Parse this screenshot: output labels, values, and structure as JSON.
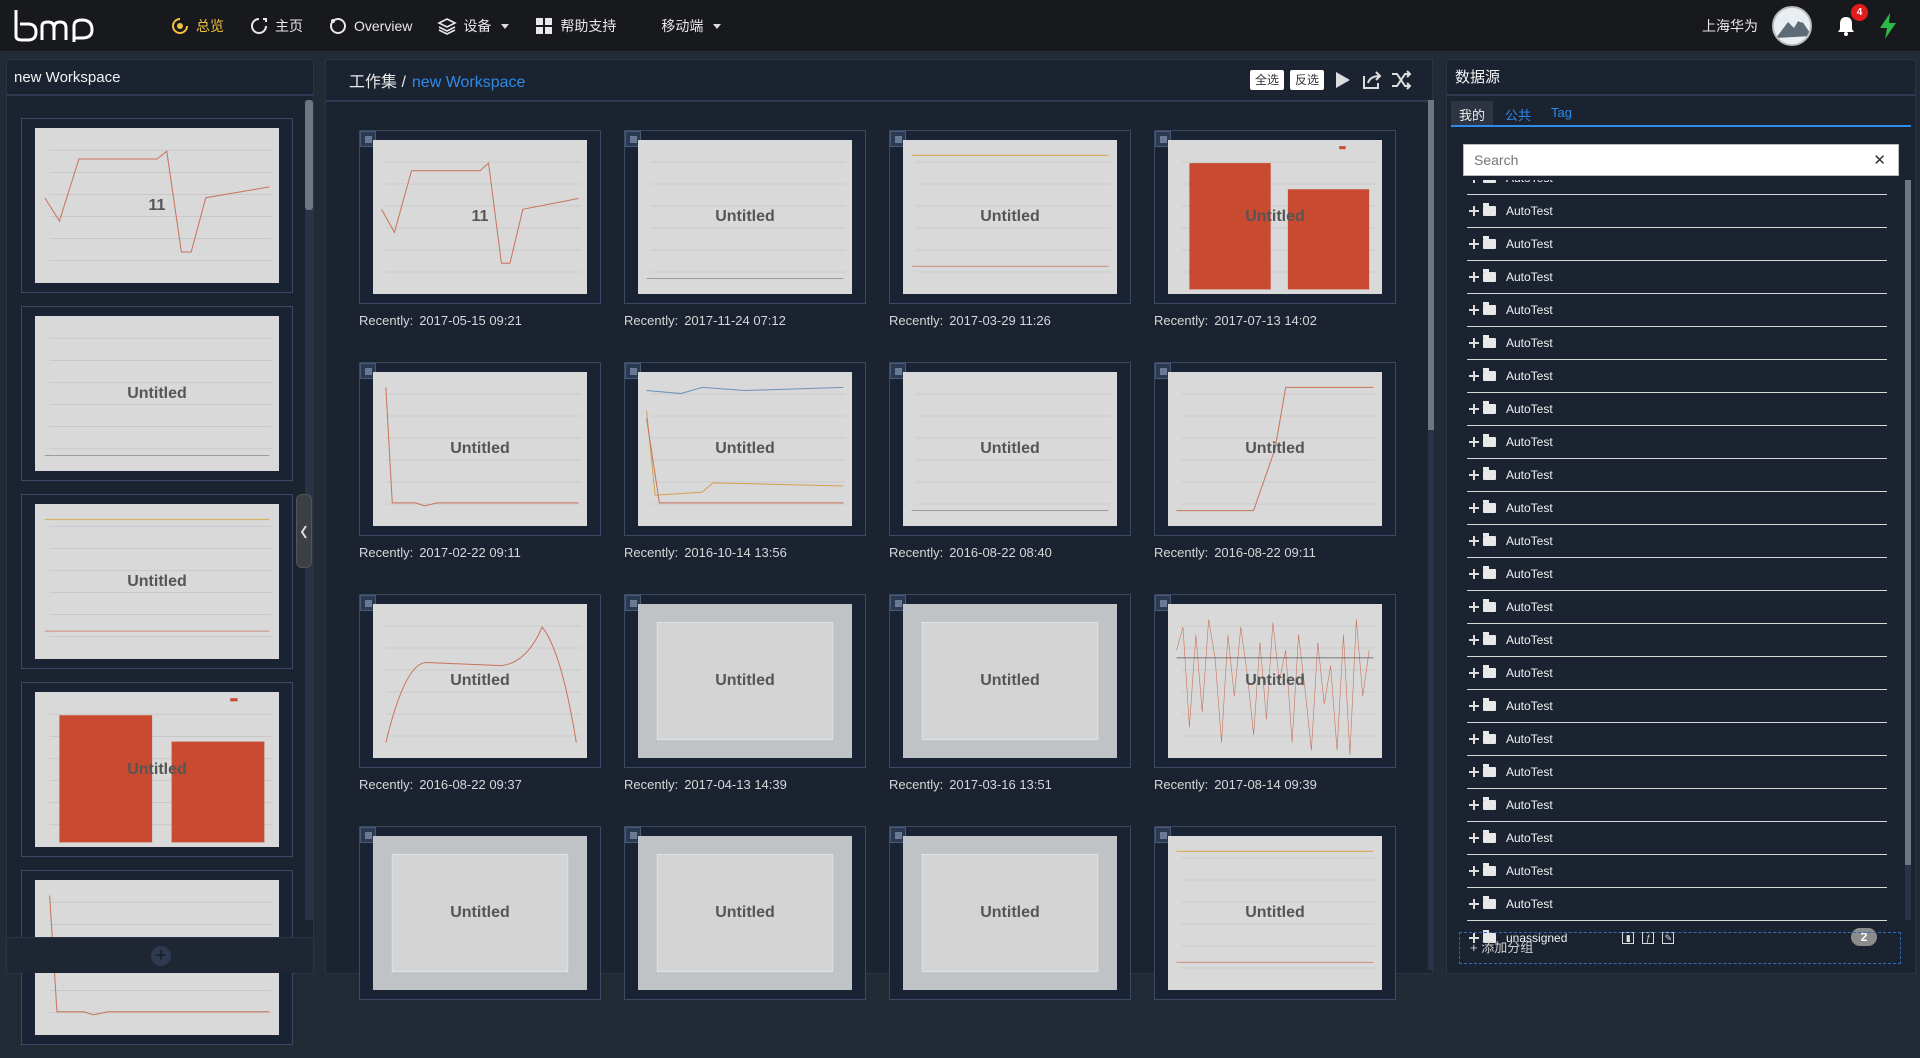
{
  "topbar": {
    "logo": "bm",
    "nav": [
      {
        "label": "总览",
        "icon": "overview-icon",
        "active": true
      },
      {
        "label": "主页",
        "icon": "home-icon",
        "active": false
      },
      {
        "label": "Overview",
        "icon": "overview2-icon",
        "active": false
      },
      {
        "label": "设备",
        "icon": "layers-icon",
        "active": false,
        "dropdown": true
      },
      {
        "label": "帮助支持",
        "icon": "grid-icon",
        "active": false
      },
      {
        "label": "移动端",
        "icon": "",
        "active": false,
        "dropdown": true
      }
    ],
    "user_name": "上海华为",
    "notification_count": "4"
  },
  "left_panel": {
    "title": "new Workspace",
    "thumbs": [
      {
        "title": "11",
        "type": "line1"
      },
      {
        "title": "Untitled",
        "type": "flat"
      },
      {
        "title": "Untitled",
        "type": "flatorange"
      },
      {
        "title": "Untitled",
        "type": "bar"
      },
      {
        "title": "",
        "type": "line2"
      }
    ]
  },
  "center": {
    "crumb_root": "工作集 /",
    "crumb_current": "new Workspace",
    "select_all": "全选",
    "invert_select": "反选",
    "recent_label": "Recently:",
    "cards": [
      {
        "title": "11",
        "date": "2017-05-15 09:21",
        "type": "line1"
      },
      {
        "title": "Untitled",
        "date": "2017-11-24 07:12",
        "type": "flat"
      },
      {
        "title": "Untitled",
        "date": "2017-03-29 11:26",
        "type": "flatorange"
      },
      {
        "title": "Untitled",
        "date": "2017-07-13 14:02",
        "type": "bar"
      },
      {
        "title": "Untitled",
        "date": "2017-02-22 09:11",
        "type": "line2"
      },
      {
        "title": "Untitled",
        "date": "2016-10-14 13:56",
        "type": "multi"
      },
      {
        "title": "Untitled",
        "date": "2016-08-22 08:40",
        "type": "flat"
      },
      {
        "title": "Untitled",
        "date": "2016-08-22 09:11",
        "type": "rise"
      },
      {
        "title": "Untitled",
        "date": "2016-08-22 09:37",
        "type": "hump"
      },
      {
        "title": "Untitled",
        "date": "2017-04-13 14:39",
        "type": "frame"
      },
      {
        "title": "Untitled",
        "date": "2017-03-16 13:51",
        "type": "frame"
      },
      {
        "title": "Untitled",
        "date": "2017-08-14 09:39",
        "type": "spiky"
      },
      {
        "title": "Untitled",
        "date": "",
        "type": "frame"
      },
      {
        "title": "Untitled",
        "date": "",
        "type": "frame"
      },
      {
        "title": "Untitled",
        "date": "",
        "type": "frame"
      },
      {
        "title": "Untitled",
        "date": "",
        "type": "flatorange"
      }
    ]
  },
  "right_panel": {
    "title": "数据源",
    "tabs": [
      {
        "label": "我的",
        "active": true
      },
      {
        "label": "公共",
        "active": false
      },
      {
        "label": "Tag",
        "active": false
      }
    ],
    "search_placeholder": "Search",
    "tree": [
      "AutoTest",
      "AutoTest",
      "AutoTest",
      "AutoTest",
      "AutoTest",
      "AutoTest",
      "AutoTest",
      "AutoTest",
      "AutoTest",
      "AutoTest",
      "AutoTest",
      "AutoTest",
      "AutoTest",
      "AutoTest",
      "AutoTest",
      "AutoTest",
      "AutoTest",
      "AutoTest",
      "AutoTest",
      "AutoTest",
      "AutoTest",
      "AutoTest"
    ],
    "unassigned_label": "unassigned",
    "unassigned_count": "2",
    "add_group": "+ 添加分组"
  },
  "colors": {
    "accent": "#2e8be8",
    "active_nav": "#f0c040",
    "bar": "#c84a30",
    "badge": "#e31b1b",
    "bolt": "#2db84a"
  }
}
